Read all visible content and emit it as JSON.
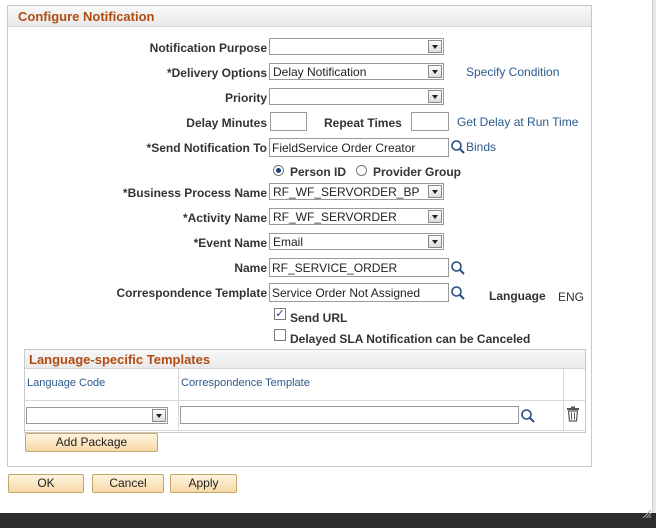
{
  "section": {
    "title": "Configure Notification"
  },
  "fields": {
    "notification_purpose": {
      "label": "Notification Purpose",
      "value": ""
    },
    "delivery_options": {
      "label": "*Delivery Options",
      "value": "Delay Notification",
      "link": "Specify Condition"
    },
    "priority": {
      "label": "Priority",
      "value": ""
    },
    "delay_minutes": {
      "label": "Delay Minutes",
      "value": ""
    },
    "repeat_times": {
      "label": "Repeat Times",
      "value": "",
      "link": "Get Delay at Run Time"
    },
    "send_notification_to": {
      "label": "*Send Notification To",
      "value": "FieldService Order Creator",
      "link": "Binds"
    },
    "recipient_type": {
      "options": [
        {
          "label": "Person ID",
          "selected": true
        },
        {
          "label": "Provider Group",
          "selected": false
        }
      ]
    },
    "business_process_name": {
      "label": "*Business Process Name",
      "value": "RF_WF_SERVORDER_BP"
    },
    "activity_name": {
      "label": "*Activity Name",
      "value": "RF_WF_SERVORDER"
    },
    "event_name": {
      "label": "*Event Name",
      "value": "Email"
    },
    "name": {
      "label": "Name",
      "value": "RF_SERVICE_ORDER"
    },
    "correspondence_template": {
      "label": "Correspondence Template",
      "value": "Service Order Not Assigned"
    },
    "language": {
      "label": "Language",
      "value": "ENG"
    },
    "send_url": {
      "label": "Send URL",
      "checked": true
    },
    "delayed_sla": {
      "label": "Delayed SLA Notification can be Canceled",
      "checked": false
    }
  },
  "language_templates": {
    "title": "Language-specific Templates",
    "columns": [
      "Language Code",
      "Correspondence Template"
    ],
    "row": {
      "language_code": "",
      "template": ""
    },
    "add_button": "Add Package"
  },
  "footer": {
    "ok": "OK",
    "cancel": "Cancel",
    "apply": "Apply"
  },
  "icons": {
    "lookup": "magnifier-icon",
    "delete": "trash-icon",
    "dropdown": "chevron-down-icon"
  }
}
